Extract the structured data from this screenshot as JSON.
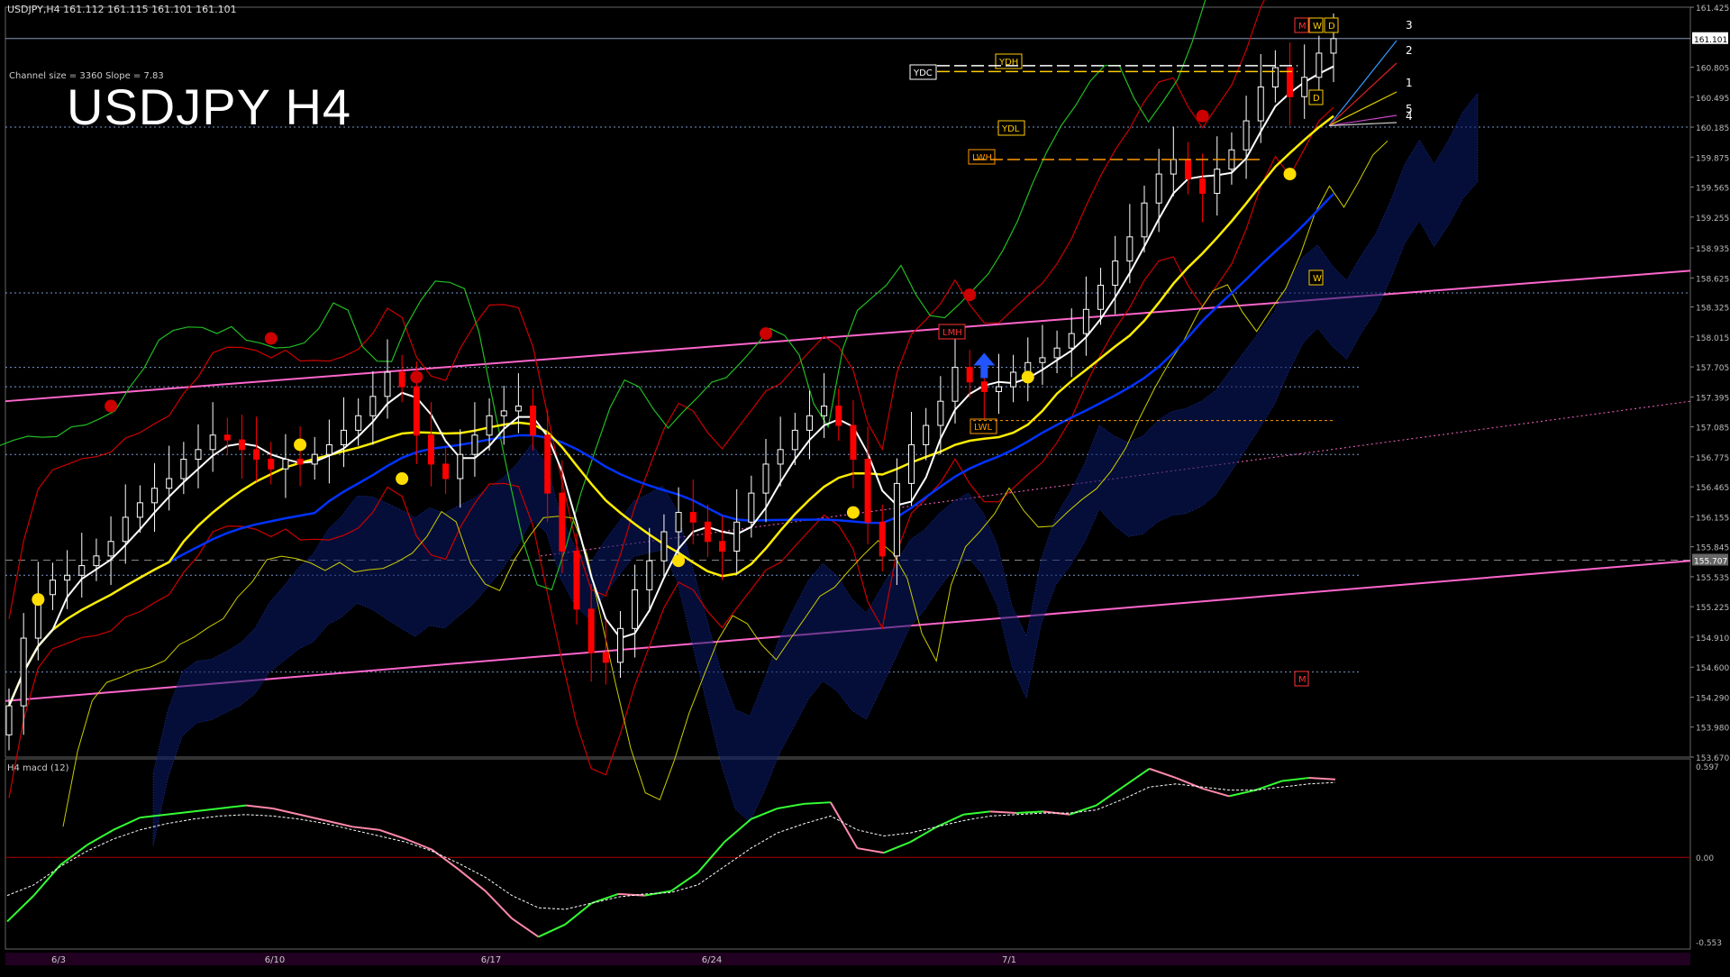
{
  "header": {
    "symbol_line": "USDJPY,H4 161.112 161.115 161.101 161.101",
    "big_title": "USDJPY H4",
    "channel_info": "Channel size = 3360 Slope = 7.83",
    "macd_label": "H4 macd (12)"
  },
  "colors": {
    "background": "#000000",
    "bull_candle": "#ffffff",
    "bear_candle": "#ff0000",
    "channel": "#ff66cc",
    "ma_white": "#ffffff",
    "ma_yellow": "#ffee00",
    "ma_blue": "#0033ff",
    "bollinger": "#cc0000",
    "envelope_yellow": "#cccc00",
    "chikou_green": "#22bb22",
    "macd_up": "#33ff33",
    "macd_down": "#ff88aa",
    "macd_signal": "#ffffff"
  },
  "chart_data": [
    {
      "type": "candlestick",
      "title": "USDJPY H4",
      "ylim": [
        153.67,
        161.425
      ],
      "y_ticks": [
        "161.425",
        "161.101",
        "160.805",
        "160.495",
        "160.185",
        "159.875",
        "159.565",
        "159.255",
        "158.935",
        "158.625",
        "158.325",
        "158.015",
        "157.705",
        "157.395",
        "157.085",
        "156.775",
        "156.465",
        "156.155",
        "155.845",
        "155.707",
        "155.535",
        "155.225",
        "154.910",
        "154.600",
        "154.290",
        "153.980",
        "153.670"
      ],
      "current_price": "161.101",
      "marked_price": "155.707",
      "x_ticks": [
        "6/3",
        "6/10",
        "6/17",
        "6/24",
        "7/1"
      ],
      "close": [
        154.2,
        154.9,
        155.35,
        155.5,
        155.55,
        155.65,
        155.75,
        155.9,
        156.15,
        156.3,
        156.45,
        156.55,
        156.75,
        156.85,
        157.0,
        156.95,
        156.85,
        156.75,
        156.65,
        156.75,
        156.7,
        156.8,
        156.9,
        157.05,
        157.2,
        157.4,
        157.65,
        157.5,
        157.0,
        156.7,
        156.55,
        156.8,
        157.0,
        157.2,
        157.25,
        157.3,
        157.0,
        156.4,
        155.8,
        155.2,
        154.75,
        154.65,
        155.0,
        155.4,
        155.7,
        156.0,
        156.2,
        156.1,
        155.9,
        155.8,
        156.1,
        156.4,
        156.7,
        156.85,
        157.05,
        157.2,
        157.3,
        157.1,
        156.75,
        156.1,
        155.75,
        156.5,
        156.9,
        157.1,
        157.35,
        157.7,
        157.55,
        157.45,
        157.5,
        157.65,
        157.75,
        157.8,
        157.9,
        158.05,
        158.3,
        158.55,
        158.8,
        159.05,
        159.4,
        159.7,
        159.85,
        159.65,
        159.5,
        159.75,
        159.95,
        160.25,
        160.6,
        160.8,
        160.5,
        160.7,
        160.95,
        161.1
      ],
      "annotations": [
        "YDC",
        "YDH",
        "YDL",
        "LWH",
        "LMH",
        "LWL",
        "M",
        "W",
        "D",
        "D",
        "W",
        "M",
        "1",
        "2",
        "3",
        "4",
        "5"
      ]
    },
    {
      "type": "line",
      "title": "H4 macd (12)",
      "ylim": [
        -0.553,
        0.597
      ],
      "y_ticks": [
        "0.597",
        "0.00",
        "-0.553"
      ],
      "series": [
        {
          "values": [
            -0.42,
            -0.25,
            -0.05,
            0.08,
            0.18,
            0.26,
            0.28,
            0.3,
            0.32,
            0.34,
            0.32,
            0.28,
            0.24,
            0.2,
            0.18,
            0.12,
            0.05,
            -0.08,
            -0.22,
            -0.4,
            -0.52,
            -0.44,
            -0.3,
            -0.24,
            -0.25,
            -0.22,
            -0.1,
            0.1,
            0.25,
            0.32,
            0.35,
            0.36,
            0.06,
            0.03,
            0.1,
            0.2,
            0.28,
            0.3,
            0.29,
            0.3,
            0.28,
            0.34,
            0.46,
            0.58,
            0.52,
            0.45,
            0.4,
            0.44,
            0.5,
            0.52,
            0.51
          ]
        },
        {
          "values": [
            -0.25,
            -0.18,
            -0.06,
            0.04,
            0.12,
            0.18,
            0.22,
            0.25,
            0.27,
            0.28,
            0.27,
            0.25,
            0.22,
            0.18,
            0.14,
            0.1,
            0.04,
            -0.04,
            -0.13,
            -0.25,
            -0.33,
            -0.34,
            -0.3,
            -0.26,
            -0.24,
            -0.23,
            -0.18,
            -0.06,
            0.06,
            0.16,
            0.22,
            0.27,
            0.18,
            0.14,
            0.16,
            0.2,
            0.24,
            0.27,
            0.28,
            0.29,
            0.29,
            0.31,
            0.38,
            0.46,
            0.48,
            0.46,
            0.44,
            0.44,
            0.46,
            0.48,
            0.49
          ]
        }
      ]
    }
  ]
}
